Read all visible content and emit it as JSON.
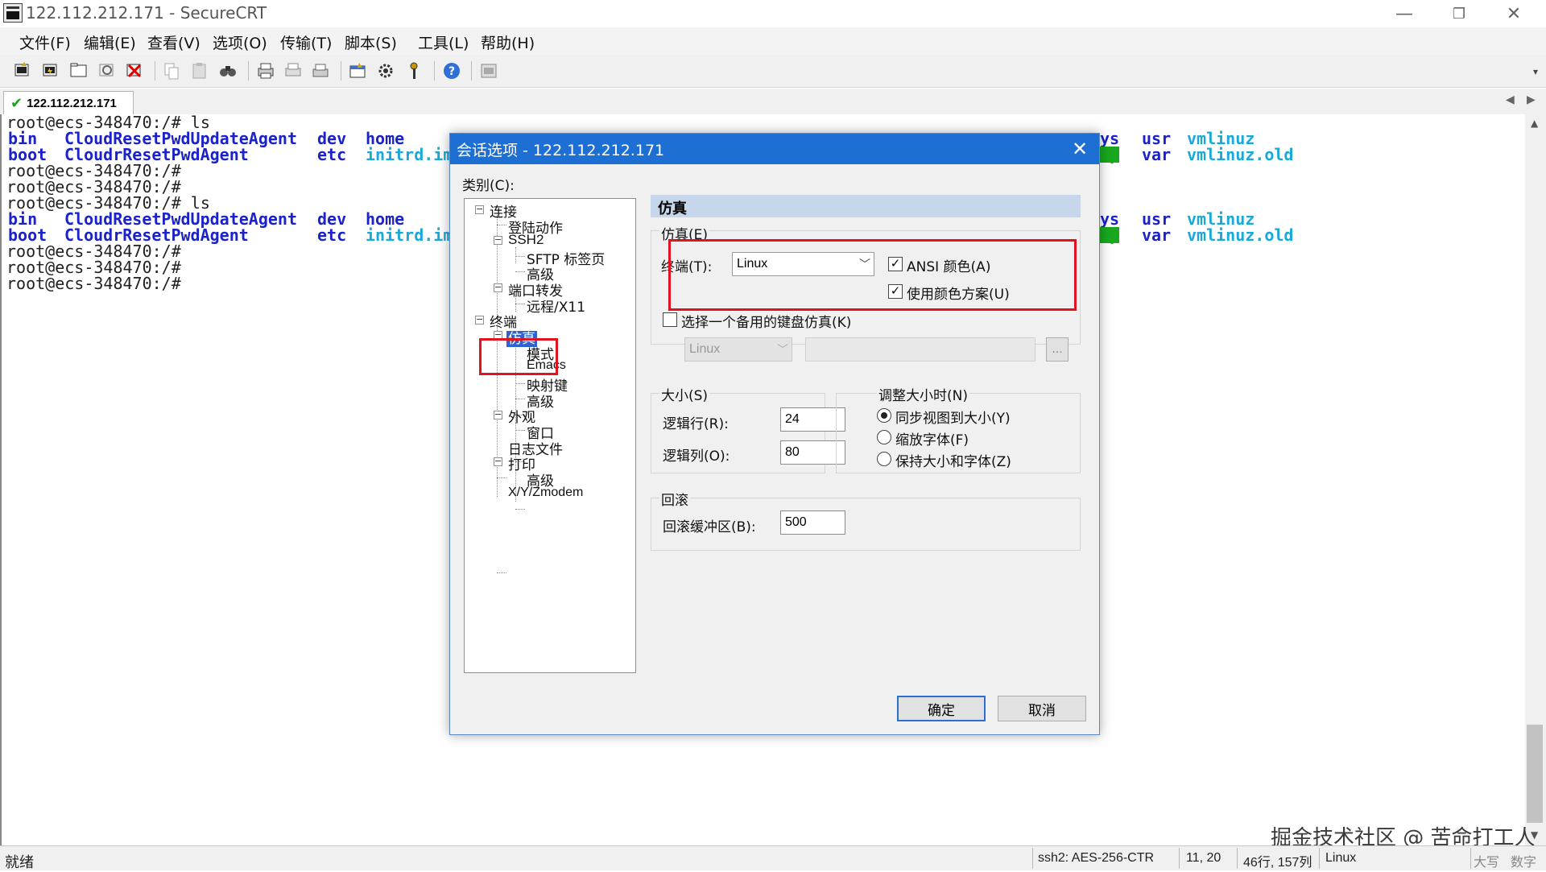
{
  "app": {
    "title": "122.112.212.171 - SecureCRT"
  },
  "window_controls": {
    "minimize": "—",
    "restore": "❐",
    "close": "✕"
  },
  "menu": [
    "文件(F)",
    "编辑(E)",
    "查看(V)",
    "选项(O)",
    "传输(T)",
    "脚本(S)",
    "工具(L)",
    "帮助(H)"
  ],
  "toolbar_icons": [
    "connect-icon",
    "quick-connect-icon",
    "connect-in-tab-icon",
    "reconnect-icon",
    "disconnect-icon",
    "copy-icon",
    "paste-icon",
    "find-icon",
    "print-icon",
    "print-selection-icon",
    "print-setup-icon",
    "session-options-icon",
    "global-options-icon",
    "keymap-icon",
    "help-icon",
    "screenshot-icon"
  ],
  "tab": {
    "label": "122.112.212.171",
    "status_icon": "✔"
  },
  "terminal": {
    "prompt_lines": [
      "root@ecs-348470:/# ls",
      "root@ecs-348470:/#",
      "root@ecs-348470:/#",
      "root@ecs-348470:/# ls",
      "root@ecs-348470:/#",
      "root@ecs-348470:/#",
      "root@ecs-348470:/#"
    ],
    "listing1": {
      "row1": [
        "bin",
        "CloudResetPwdUpdateAgent",
        "dev",
        "home",
        "ys",
        "usr",
        "vmlinuz"
      ],
      "row2": [
        "boot",
        "CloudrResetPwdAgent",
        "etc",
        "initrd.im",
        "mp",
        "var",
        "vmlinuz.old"
      ]
    },
    "listing2": {
      "row1": [
        "bin",
        "CloudResetPwdUpdateAgent",
        "dev",
        "home",
        "ys",
        "usr",
        "vmlinuz"
      ],
      "row2": [
        "boot",
        "CloudrResetPwdAgent",
        "etc",
        "initrd.im",
        "mp",
        "var",
        "vmlinuz.old"
      ]
    }
  },
  "status": {
    "ready": "就绪",
    "cipher": "ssh2: AES-256-CTR",
    "cursor": "11,  20",
    "size": "46行, 157列",
    "emulation": "Linux",
    "caps": "大写",
    "num": "数字"
  },
  "watermark": "掘金技术社区 @ 苦命打工人",
  "dialog": {
    "title": "会话选项 - 122.112.212.171",
    "category_label": "类别(C):",
    "tree": {
      "connection": "连接",
      "login_actions": "登陆动作",
      "ssh2": "SSH2",
      "sftp_tab": "SFTP 标签页",
      "ssh2_advanced": "高级",
      "port_forward": "端口转发",
      "remote_x11": "远程/X11",
      "terminal": "终端",
      "emulation": "仿真",
      "modes": "模式",
      "emacs": "Emacs",
      "mapped_keys": "映射键",
      "emul_advanced": "高级",
      "appearance": "外观",
      "window": "窗口",
      "log_file": "日志文件",
      "print": "打印",
      "print_advanced": "高级",
      "xyzmodem": "X/Y/Zmodem"
    },
    "panel_title": "仿真",
    "emulation_group": "仿真(E)",
    "terminal_label": "终端(T):",
    "terminal_value": "Linux",
    "ansi_color": {
      "label": "ANSI 颜色(A)",
      "checked": true
    },
    "color_scheme": {
      "label": "使用颜色方案(U)",
      "checked": true
    },
    "alt_keyboard": {
      "label": "选择一个备用的键盘仿真(K)",
      "checked": false
    },
    "alt_keyboard_value": "Linux",
    "browse": "...",
    "size_group": "大小(S)",
    "logical_rows_label": "逻辑行(R):",
    "logical_rows": "24",
    "logical_cols_label": "逻辑列(O):",
    "logical_cols": "80",
    "resize_group": "调整大小时(N)",
    "resize_options": [
      {
        "label": "同步视图到大小(Y)",
        "selected": true
      },
      {
        "label": "缩放字体(F)",
        "selected": false
      },
      {
        "label": "保持大小和字体(Z)",
        "selected": false
      }
    ],
    "scrollback_group": "回滚",
    "scrollback_label": "回滚缓冲区(B):",
    "scrollback_value": "500",
    "ok": "确定",
    "cancel": "取消"
  }
}
